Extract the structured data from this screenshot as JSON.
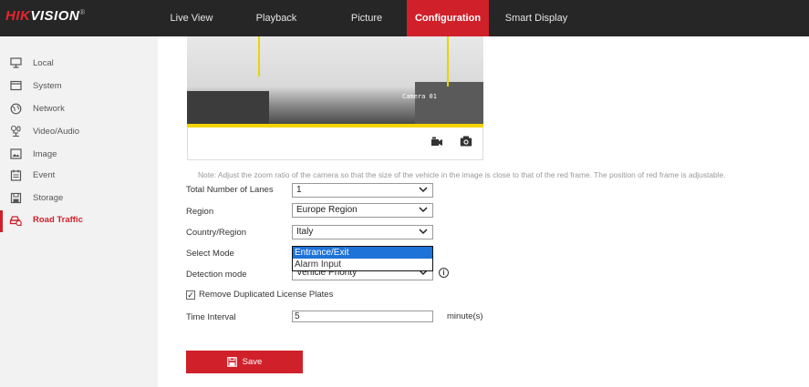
{
  "header": {
    "logo_brand": "HIKVISION",
    "logo_red_part": "HIK",
    "logo_white_part": "VISION",
    "logo_reg": "®",
    "nav": [
      {
        "label": "Live View"
      },
      {
        "label": "Playback"
      },
      {
        "label": "Picture"
      },
      {
        "label": "Configuration",
        "active": true
      },
      {
        "label": "Smart Display"
      }
    ]
  },
  "sidebar": {
    "items": [
      {
        "label": "Local",
        "icon": "monitor-icon"
      },
      {
        "label": "System",
        "icon": "window-icon"
      },
      {
        "label": "Network",
        "icon": "globe-icon"
      },
      {
        "label": "Video/Audio",
        "icon": "microphone-icon"
      },
      {
        "label": "Image",
        "icon": "image-icon"
      },
      {
        "label": "Event",
        "icon": "calendar-icon"
      },
      {
        "label": "Storage",
        "icon": "floppy-icon"
      },
      {
        "label": "Road Traffic",
        "icon": "car-icon",
        "active": true
      }
    ]
  },
  "video": {
    "camera_name": "Camera 01",
    "toolbar_icons": [
      "record-icon",
      "capture-icon"
    ]
  },
  "form": {
    "note": "Note: Adjust the zoom ratio of the camera so that the size of the vehicle in the image is close to that of the red frame. The position of red frame is adjustable.",
    "total_lanes_label": "Total Number of Lanes",
    "total_lanes_value": "1",
    "region_label": "Region",
    "region_value": "Europe Region",
    "country_label": "Country/Region",
    "country_value": "Italy",
    "select_mode_label": "Select Mode",
    "select_mode_options": [
      "Entrance/Exit",
      "Alarm Input"
    ],
    "select_mode_highlighted": "Entrance/Exit",
    "detection_mode_label": "Detection mode",
    "detection_mode_value": "Vehicle Priority",
    "remove_duplicates_label": "Remove Duplicated License Plates",
    "remove_duplicates_checked": true,
    "time_interval_label": "Time Interval",
    "time_interval_value": "5",
    "time_interval_unit": "minute(s)",
    "save_label": "Save"
  },
  "colors": {
    "accent_red": "#d0202a",
    "topbar": "#262626",
    "sidebar_bg": "#f2f2f2",
    "dropdown_highlight": "#1e73d8",
    "roi_line": "#e8d400"
  }
}
